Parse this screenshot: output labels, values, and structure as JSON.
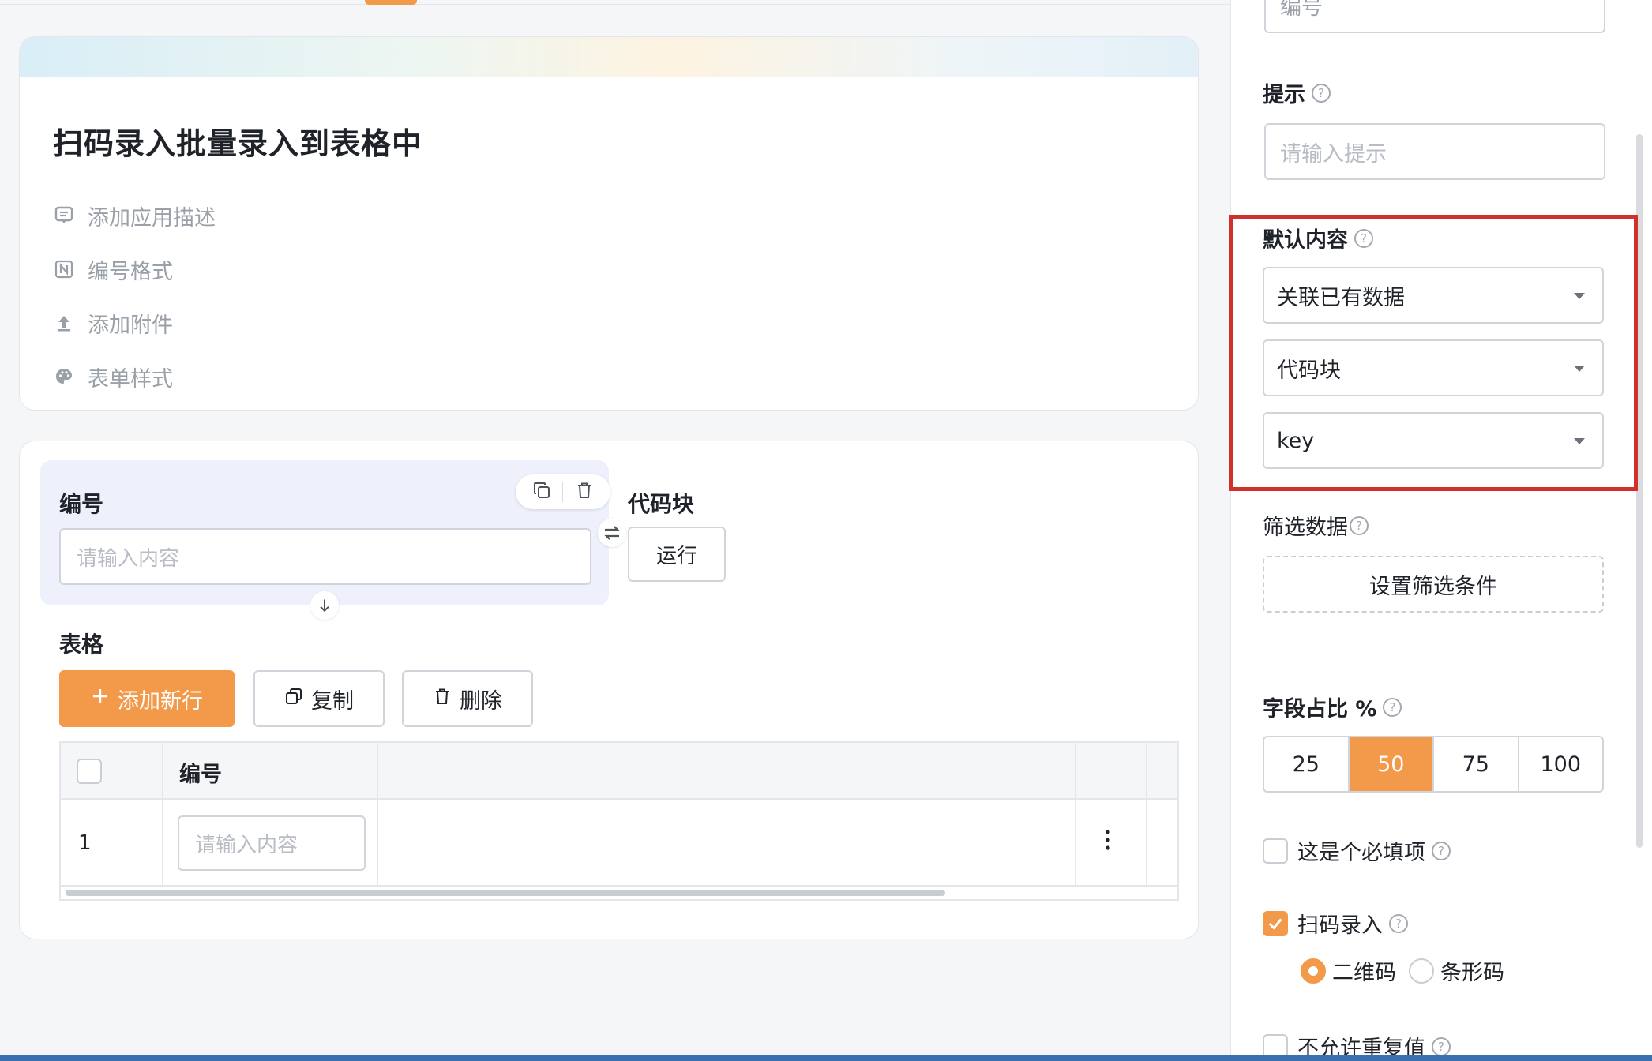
{
  "header": {
    "title": "扫码录入批量录入到表格中",
    "meta_items": [
      {
        "icon": "comment-icon",
        "label": "添加应用描述"
      },
      {
        "icon": "number-format-icon",
        "label": "编号格式"
      },
      {
        "icon": "upload-icon",
        "label": "添加附件"
      },
      {
        "icon": "palette-icon",
        "label": "表单样式"
      }
    ]
  },
  "form": {
    "field1": {
      "label": "编号",
      "placeholder": "请输入内容"
    },
    "field2": {
      "label": "代码块",
      "run_label": "运行"
    },
    "table": {
      "label": "表格",
      "add_row_label": "添加新行",
      "copy_label": "复制",
      "delete_label": "删除",
      "columns": [
        "编号"
      ],
      "rows": [
        {
          "index": "1",
          "placeholder": "请输入内容"
        }
      ]
    }
  },
  "panel": {
    "top_input_value": "编号",
    "hint": {
      "label": "提示",
      "placeholder": "请输入提示"
    },
    "default_content": {
      "label": "默认内容",
      "select1": "关联已有数据",
      "select2": "代码块",
      "select3": "key"
    },
    "filter": {
      "label": "筛选数据",
      "button": "设置筛选条件"
    },
    "width_ratio": {
      "label": "字段占比 %",
      "options": [
        "25",
        "50",
        "75",
        "100"
      ],
      "selected": "50"
    },
    "required": {
      "label": "这是个必填项",
      "checked": false
    },
    "scan": {
      "label": "扫码录入",
      "checked": true,
      "options": [
        "二维码",
        "条形码"
      ],
      "selected": "二维码"
    },
    "no_duplicate": {
      "label": "不允许重复值",
      "checked": false
    }
  },
  "colors": {
    "accent": "#f29a4a",
    "highlight": "#d0322b"
  }
}
